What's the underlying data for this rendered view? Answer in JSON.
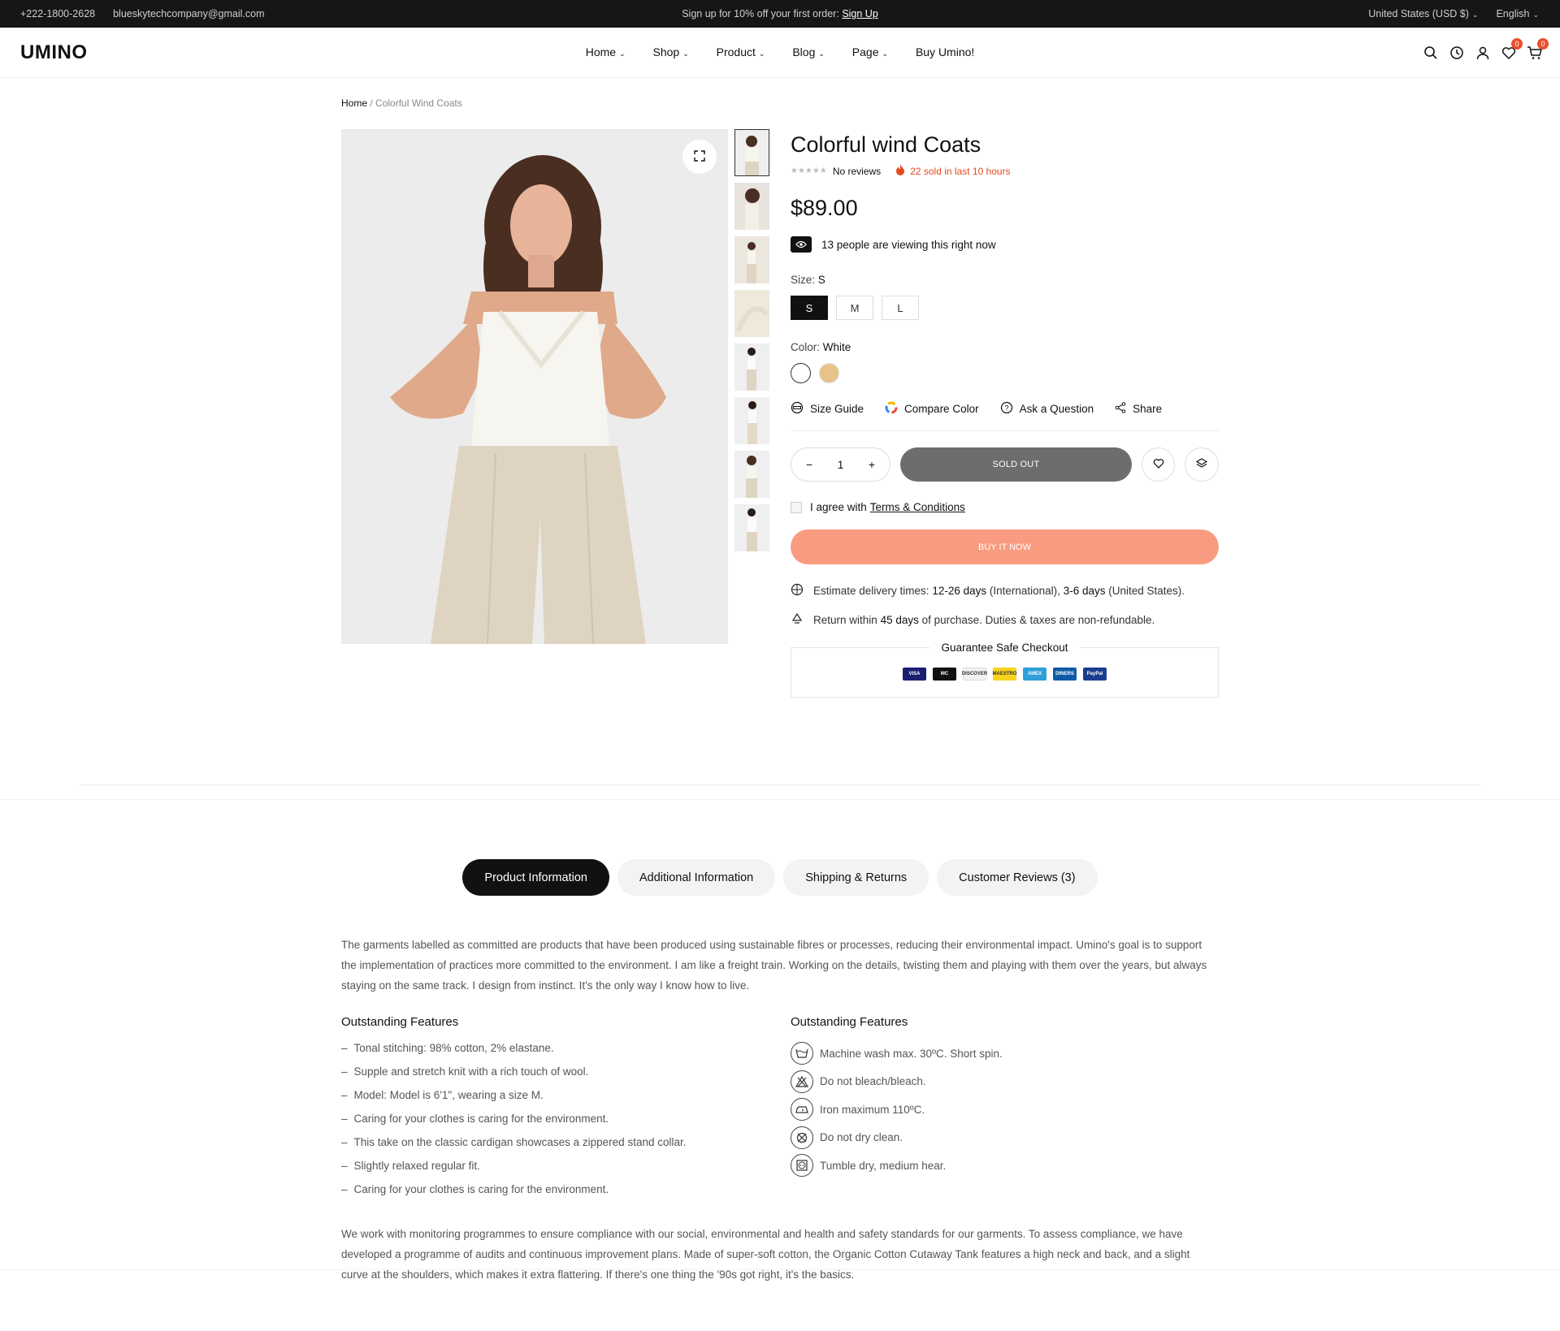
{
  "topbar": {
    "phone": "+222-1800-2628",
    "email": "blueskytechcompany@gmail.com",
    "promo_text": "Sign up for 10% off your first order:",
    "promo_link": "Sign Up",
    "currency": "United States (USD $)",
    "language": "English"
  },
  "header": {
    "logo": "UMINO",
    "nav": [
      "Home",
      "Shop",
      "Product",
      "Blog",
      "Page",
      "Buy Umino!"
    ],
    "wishlist_count": "0",
    "cart_count": "0"
  },
  "breadcrumb": {
    "home": "Home",
    "separator": "/",
    "current": "Colorful Wind Coats"
  },
  "product": {
    "title": "Colorful wind Coats",
    "rating": 0,
    "reviews_text": "No reviews",
    "sold_text": "22 sold in last 10 hours",
    "price": "$89.00",
    "viewing_text": "13 people are viewing this right now",
    "size_label": "Size:",
    "size_selected": "S",
    "sizes": [
      "S",
      "M",
      "L"
    ],
    "color_label": "Color:",
    "color_selected": "White",
    "colors": [
      "#ffffff",
      "#e8c389"
    ],
    "tools": {
      "size_guide": "Size Guide",
      "compare_color": "Compare Color",
      "ask_question": "Ask a Question",
      "share": "Share"
    },
    "quantity": "1",
    "qty_minus": "−",
    "qty_plus": "+",
    "sold_out_label": "SOLD OUT",
    "agree_text": "I agree with",
    "terms_link": "Terms & Conditions",
    "buy_now_label": "BUY IT NOW",
    "delivery": {
      "prefix": "Estimate delivery times:",
      "intl_days": "12-26 days",
      "intl_label": "(International),",
      "us_days": "3-6 days",
      "us_label": "(United States)."
    },
    "returns": {
      "prefix": "Return within",
      "days": "45 days",
      "suffix": "of purchase. Duties & taxes are non-refundable."
    },
    "guarantee_title": "Guarantee Safe Checkout",
    "payment_cards": [
      {
        "name": "VISA",
        "color": "#1a1f71"
      },
      {
        "name": "MC",
        "color": "#111111"
      },
      {
        "name": "DISCOVER",
        "color": "#f2f2f2"
      },
      {
        "name": "MAESTRO",
        "color": "#f7d51d"
      },
      {
        "name": "AMEX",
        "color": "#2e9fd8"
      },
      {
        "name": "DINERS",
        "color": "#0e5aa7"
      },
      {
        "name": "PayPal",
        "color": "#1a3d8f"
      }
    ]
  },
  "tabs": [
    "Product Information",
    "Additional Information",
    "Shipping & Returns",
    "Customer Reviews (3)"
  ],
  "active_tab": 0,
  "content": {
    "intro": "The garments labelled as committed are products that have been produced using sustainable fibres or processes, reducing their environmental impact. Umino's goal is to support the implementation of practices more committed to the environment. I am like a freight train. Working on the details, twisting them and playing with them over the years, but always staying on the same track. I design from instinct. It's the only way I know how to live.",
    "features_title": "Outstanding Features",
    "features": [
      "Tonal stitching: 98% cotton, 2% elastane.",
      "Supple and stretch knit with a rich touch of wool.",
      "Model:  Model is 6'1\", wearing a size M.",
      "Caring for your clothes is caring for the environment.",
      "This take on the classic cardigan showcases a zippered stand collar.",
      "Slightly relaxed regular fit.",
      "Caring for your clothes is caring for the environment."
    ],
    "care_title": "Outstanding Features",
    "care": [
      {
        "icon": "wash-icon",
        "text": "Machine wash max. 30ºC. Short spin."
      },
      {
        "icon": "no-bleach-icon",
        "text": "Do not bleach/bleach."
      },
      {
        "icon": "iron-icon",
        "text": "Iron maximum 110ºC."
      },
      {
        "icon": "no-dry-clean-icon",
        "text": "Do not dry clean."
      },
      {
        "icon": "tumble-dry-icon",
        "text": "Tumble dry, medium hear."
      }
    ],
    "outro": "We work with monitoring programmes to ensure compliance with our social, environmental and health and safety standards for our garments. To assess compliance, we have developed a programme of audits and continuous improvement plans. Made of super-soft cotton, the Organic Cotton Cutaway Tank features a high neck and back, and a slight curve at the shoulders, which makes it extra flattering. If there's one thing the '90s got right, it's the basics."
  }
}
